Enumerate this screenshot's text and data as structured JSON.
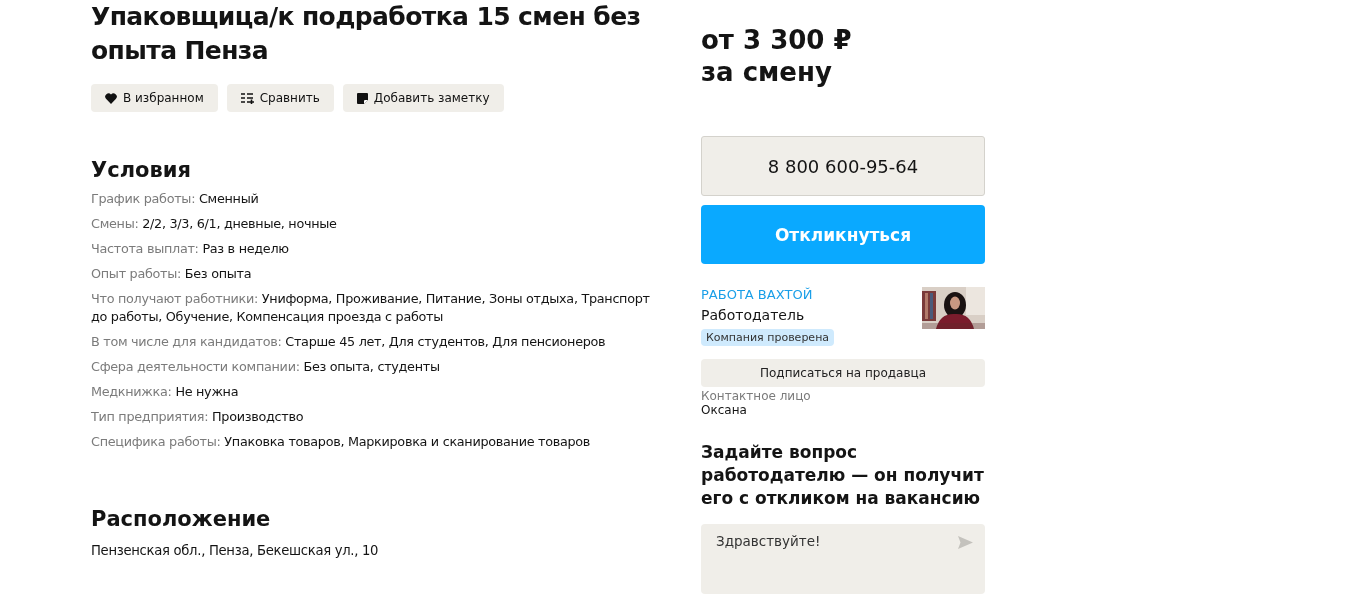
{
  "title": "Упаковщица/к подработка 15 смен без опыта Пенза",
  "actions": [
    {
      "kind": "favorite",
      "label": "В избранном"
    },
    {
      "kind": "compare",
      "label": "Сравнить"
    },
    {
      "kind": "note",
      "label": "Добавить заметку"
    }
  ],
  "conditions": {
    "heading": "Условия",
    "items": [
      {
        "label": "График работы:",
        "value": "Сменный"
      },
      {
        "label": "Смены:",
        "value": "2/2, 3/3, 6/1, дневные, ночные"
      },
      {
        "label": "Частота выплат:",
        "value": "Раз в неделю"
      },
      {
        "label": "Опыт работы:",
        "value": "Без опыта"
      },
      {
        "label": "Что получают работники:",
        "value": "Униформа, Проживание, Питание, Зоны отдыха, Транспорт до работы, Обучение, Компенсация проезда с работы"
      },
      {
        "label": "В том числе для кандидатов:",
        "value": "Старше 45 лет, Для студентов, Для пенсионеров"
      },
      {
        "label": "Сфера деятельности компании:",
        "value": "Без опыта, студенты"
      },
      {
        "label": "Медкнижка:",
        "value": "Не нужна"
      },
      {
        "label": "Тип предприятия:",
        "value": "Производство"
      },
      {
        "label": "Специфика работы:",
        "value": "Упаковка товаров, Маркировка и сканирование товаров"
      }
    ]
  },
  "location": {
    "heading": "Расположение",
    "address": "Пензенская обл., Пенза, Бекешская ул., 10"
  },
  "price": {
    "amount": "от 3 300 ₽",
    "period": "за смену"
  },
  "phone": "8 800 600-95-64",
  "respond_button": "Откликнуться",
  "employer": {
    "name": "РАБОТА ВАХТОЙ",
    "role": "Работодатель",
    "badge": "Компания проверена"
  },
  "subscribe_button": "Подписаться на продавца",
  "contact": {
    "label": "Контактное лицо",
    "name": "Оксана"
  },
  "question": {
    "heading": "Задайте вопрос работодателю — он получит его с откликом на вакансию",
    "value": "Здравствуйте!"
  }
}
